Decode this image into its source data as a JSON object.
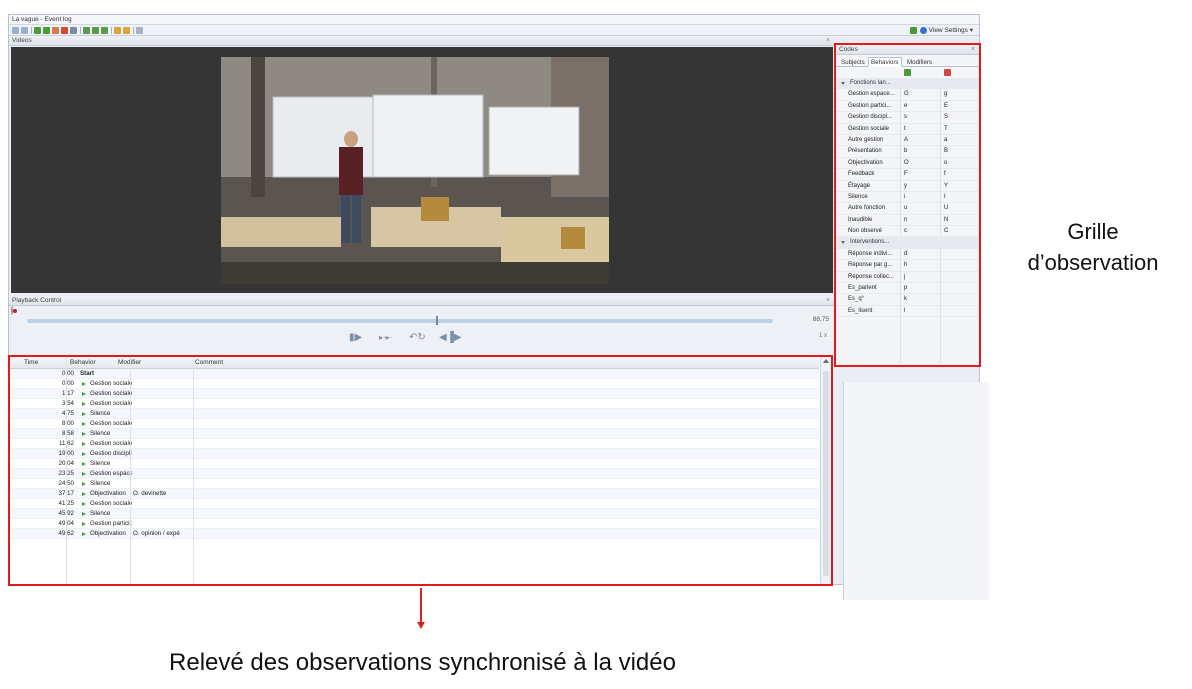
{
  "window": {
    "title": "La vague - Event log"
  },
  "toolbar": {
    "view_settings": "View Settings ▾"
  },
  "videos": {
    "title": "Videos",
    "close": "×"
  },
  "playback": {
    "title": "Playback Control",
    "close": "×",
    "time": "88,75",
    "speed": "1 x",
    "progress": 0.55
  },
  "log": {
    "columns": {
      "time": "Time",
      "behavior": "Behavior",
      "modifier": "Modifier",
      "comment": "Comment"
    },
    "rows": [
      {
        "time": "0,00",
        "behavior": "Start",
        "modifier": "",
        "is_start": true
      },
      {
        "time": "0,00",
        "behavior": "Gestion sociale",
        "modifier": ""
      },
      {
        "time": "1,17",
        "behavior": "Gestion sociale",
        "modifier": ""
      },
      {
        "time": "3,54",
        "behavior": "Gestion sociale",
        "modifier": ""
      },
      {
        "time": "4,75",
        "behavior": "Silence",
        "modifier": ""
      },
      {
        "time": "8,00",
        "behavior": "Gestion sociale",
        "modifier": ""
      },
      {
        "time": "8,58",
        "behavior": "Silence",
        "modifier": ""
      },
      {
        "time": "11,62",
        "behavior": "Gestion sociale",
        "modifier": ""
      },
      {
        "time": "19,00",
        "behavior": "Gestion disciplin",
        "modifier": ""
      },
      {
        "time": "20,04",
        "behavior": "Silence",
        "modifier": ""
      },
      {
        "time": "23,25",
        "behavior": "Gestion espace /",
        "modifier": ""
      },
      {
        "time": "24,50",
        "behavior": "Silence",
        "modifier": ""
      },
      {
        "time": "37,17",
        "behavior": "Objectivation",
        "modifier": "O. devinette"
      },
      {
        "time": "41,25",
        "behavior": "Gestion sociale",
        "modifier": ""
      },
      {
        "time": "45,92",
        "behavior": "Silence",
        "modifier": ""
      },
      {
        "time": "49,04",
        "behavior": "Gestion participa",
        "modifier": ""
      },
      {
        "time": "49,62",
        "behavior": "Objectivation",
        "modifier": "O. opinion / expé"
      }
    ]
  },
  "codes": {
    "title": "Codes",
    "close": "×",
    "tabs": [
      "Subjects",
      "Behaviors",
      "Modifiers"
    ],
    "active_tab": 1,
    "rows": [
      {
        "group": true,
        "name": "Fonctions lan..."
      },
      {
        "name": "Gestion espace...",
        "k1": "G",
        "k2": "g"
      },
      {
        "name": "Gestion partici...",
        "k1": "e",
        "k2": "E"
      },
      {
        "name": "Gestion discipl...",
        "k1": "s",
        "k2": "S"
      },
      {
        "name": "Gestion sociale",
        "k1": "t",
        "k2": "T"
      },
      {
        "name": "Autre gestion",
        "k1": "A",
        "k2": "a"
      },
      {
        "name": "Présentation",
        "k1": "b",
        "k2": "B"
      },
      {
        "name": "Objectivation",
        "k1": "O",
        "k2": "o"
      },
      {
        "name": "Feedback",
        "k1": "F",
        "k2": "f"
      },
      {
        "name": "Étayage",
        "k1": "y",
        "k2": "Y"
      },
      {
        "name": "Silence",
        "k1": "i",
        "k2": "I"
      },
      {
        "name": "Autre fonction",
        "k1": "u",
        "k2": "U"
      },
      {
        "name": "Inaudible",
        "k1": "n",
        "k2": "N"
      },
      {
        "name": "Non observé",
        "k1": "c",
        "k2": "C"
      },
      {
        "group": true,
        "name": "Interventions..."
      },
      {
        "name": "Réponse indivi...",
        "k1": "d",
        "k2": ""
      },
      {
        "name": "Réponse par g...",
        "k1": "h",
        "k2": ""
      },
      {
        "name": "Réponse collec...",
        "k1": "j",
        "k2": ""
      },
      {
        "name": "Es_parlent",
        "k1": "p",
        "k2": ""
      },
      {
        "name": "Es_q°",
        "k1": "k",
        "k2": ""
      },
      {
        "name": "Es_lisent",
        "k1": "l",
        "k2": ""
      }
    ]
  },
  "annotations": {
    "grille": "Grille d’observation",
    "caption": "Relevé des observations synchronisé à la vidéo"
  },
  "colors": {
    "highlight": "#e01b1b",
    "accent_green": "#3aa63a"
  }
}
